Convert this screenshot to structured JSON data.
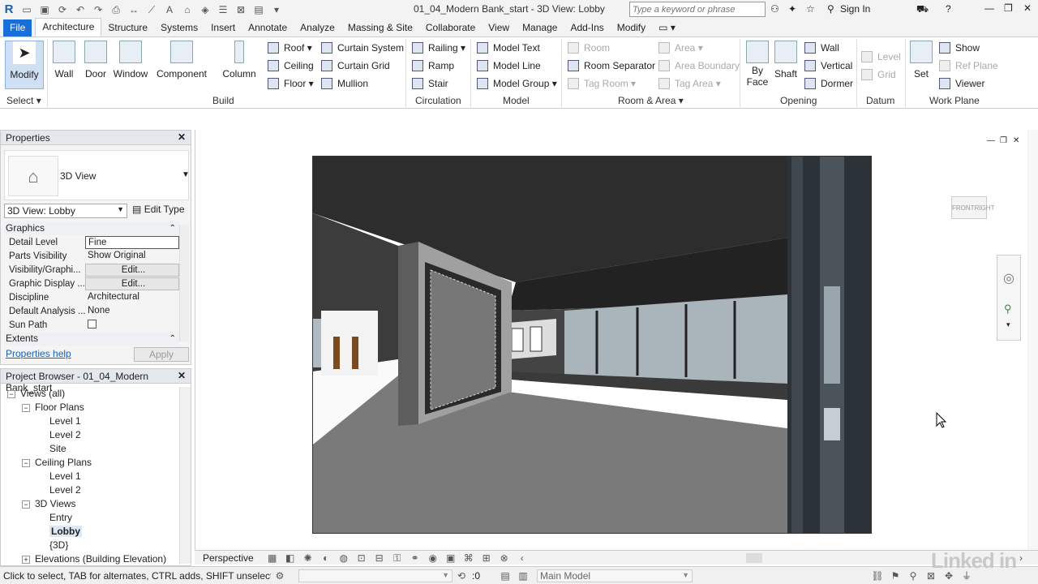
{
  "app": {
    "title": "01_04_Modern Bank_start - 3D View: Lobby",
    "search_placeholder": "Type a keyword or phrase",
    "sign_in": "Sign In",
    "logo": "R"
  },
  "tabs": [
    "File",
    "Architecture",
    "Structure",
    "Systems",
    "Insert",
    "Annotate",
    "Analyze",
    "Massing & Site",
    "Collaborate",
    "View",
    "Manage",
    "Add-Ins",
    "Modify"
  ],
  "ribbon": {
    "select": {
      "modify": "Modify",
      "panel": "Select"
    },
    "build": {
      "wall": "Wall",
      "door": "Door",
      "window": "Window",
      "component": "Component",
      "column": "Column",
      "roof": "Roof",
      "ceiling": "Ceiling",
      "floor": "Floor",
      "curtain_system": "Curtain System",
      "curtain_grid": "Curtain Grid",
      "mullion": "Mullion",
      "panel": "Build"
    },
    "circulation": {
      "railing": "Railing",
      "ramp": "Ramp",
      "stair": "Stair",
      "panel": "Circulation"
    },
    "model": {
      "model_text": "Model Text",
      "model_line": "Model Line",
      "model_group": "Model Group",
      "panel": "Model"
    },
    "room_area": {
      "room": "Room",
      "room_separator": "Room Separator",
      "tag_room": "Tag Room",
      "area": "Area",
      "area_boundary": "Area Boundary",
      "tag_area": "Tag Area",
      "panel": "Room & Area"
    },
    "opening": {
      "by_face": "By Face",
      "shaft": "Shaft",
      "wall": "Wall",
      "vertical": "Vertical",
      "dormer": "Dormer",
      "by": "By",
      "face": "Face",
      "panel": "Opening"
    },
    "datum": {
      "level": "Level",
      "grid": "Grid",
      "panel": "Datum"
    },
    "work_plane": {
      "set": "Set",
      "show": "Show",
      "ref_plane": "Ref Plane",
      "viewer": "Viewer",
      "panel": "Work Plane"
    }
  },
  "properties": {
    "title": "Properties",
    "type_name": "3D View",
    "view_selector": "3D View: Lobby",
    "edit_type": "Edit Type",
    "group_graphics": "Graphics",
    "rows": [
      {
        "key": "Detail Level",
        "value": "Fine"
      },
      {
        "key": "Parts Visibility",
        "value": "Show Original"
      },
      {
        "key": "Visibility/Graphi...",
        "value": "Edit..."
      },
      {
        "key": "Graphic Display ...",
        "value": "Edit..."
      },
      {
        "key": "Discipline",
        "value": "Architectural"
      },
      {
        "key": "Default Analysis ...",
        "value": "None"
      },
      {
        "key": "Sun Path",
        "value": ""
      }
    ],
    "group_extents": "Extents",
    "help": "Properties help",
    "apply": "Apply"
  },
  "browser": {
    "title": "Project Browser - 01_04_Modern Bank_start",
    "items": [
      {
        "label": "Views (all)",
        "indent": 0,
        "toggle": "−"
      },
      {
        "label": "Floor Plans",
        "indent": 1,
        "toggle": "−"
      },
      {
        "label": "Level 1",
        "indent": 2,
        "toggle": ""
      },
      {
        "label": "Level 2",
        "indent": 2,
        "toggle": ""
      },
      {
        "label": "Site",
        "indent": 2,
        "toggle": ""
      },
      {
        "label": "Ceiling Plans",
        "indent": 1,
        "toggle": "−"
      },
      {
        "label": "Level 1",
        "indent": 2,
        "toggle": ""
      },
      {
        "label": "Level 2",
        "indent": 2,
        "toggle": ""
      },
      {
        "label": "3D Views",
        "indent": 1,
        "toggle": "−"
      },
      {
        "label": "Entry",
        "indent": 2,
        "toggle": ""
      },
      {
        "label": "Lobby",
        "indent": 2,
        "toggle": "",
        "selected": true
      },
      {
        "label": "{3D}",
        "indent": 2,
        "toggle": ""
      },
      {
        "label": "Elevations (Building Elevation)",
        "indent": 1,
        "toggle": "+"
      }
    ]
  },
  "viewport": {
    "view_control": "Perspective",
    "viewcube_front": "FRONT",
    "viewcube_right": "RIGHT"
  },
  "status": {
    "message": "Click to select, TAB for alternates, CTRL adds, SHIFT unselects.",
    "scale_value": ":0",
    "model": "Main Model"
  },
  "watermark": "Linked in"
}
